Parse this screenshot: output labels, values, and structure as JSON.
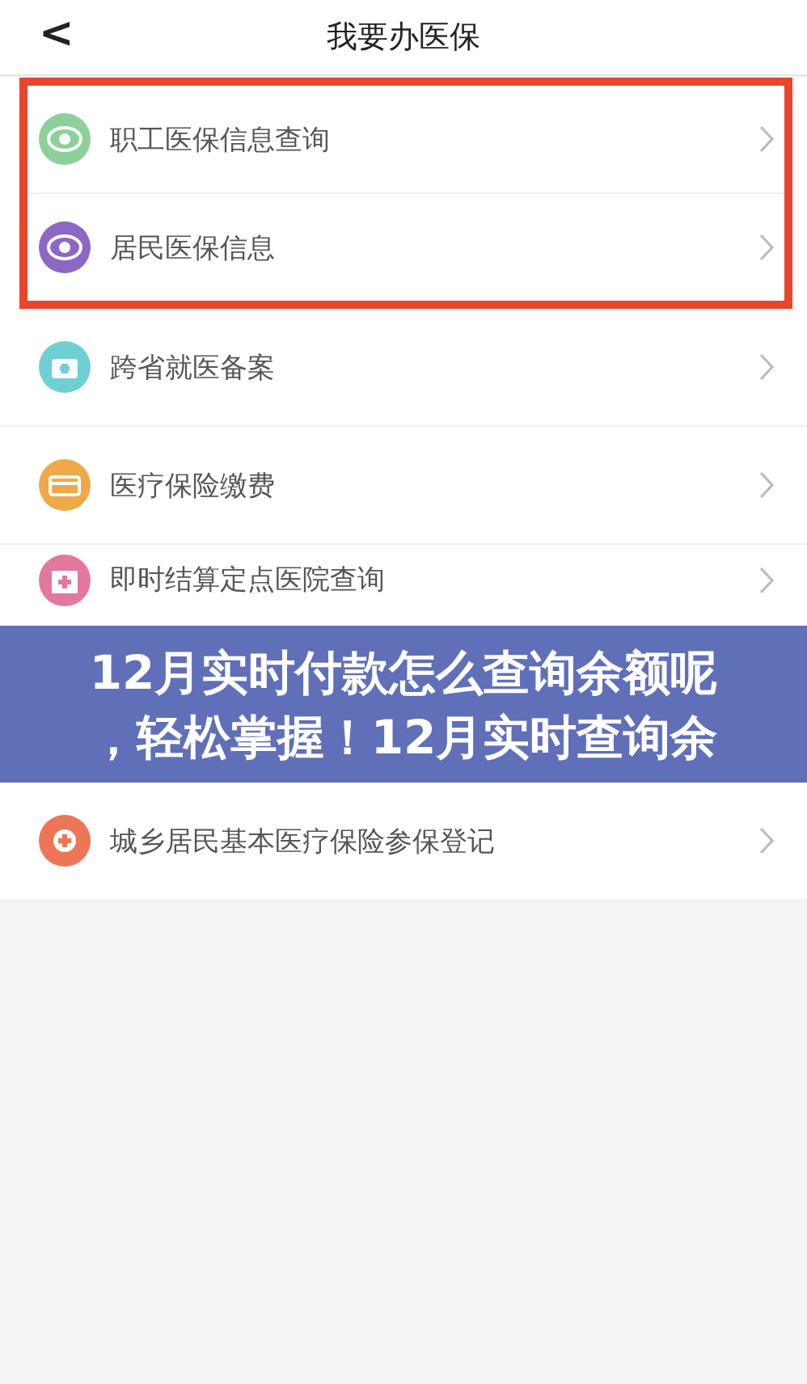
{
  "header": {
    "back": "<",
    "title": "我要办医保"
  },
  "items": [
    {
      "kind": "row",
      "label": "职工医保信息查询",
      "color": "#8dd09c",
      "highlighted": true
    },
    {
      "kind": "row",
      "label": "居民医保信息",
      "color": "#8a68c4",
      "highlighted": true
    },
    {
      "kind": "row",
      "label": "跨省就医备案",
      "color": "#70cfd2",
      "highlighted": false
    },
    {
      "kind": "row",
      "label": "医疗保险缴费",
      "color": "#f0a947",
      "highlighted": false
    },
    {
      "kind": "row",
      "label": "即时结算定点医院查询",
      "color": "#e2789c",
      "highlighted": false
    },
    {
      "kind": "banner",
      "lines": [
        "12月实时付款怎么查询余额呢",
        "，轻松掌握！12月实时查询余"
      ]
    },
    {
      "kind": "row",
      "label": "城乡居民基本医疗保险参保登记",
      "color": "#ee7656",
      "highlighted": false
    }
  ]
}
